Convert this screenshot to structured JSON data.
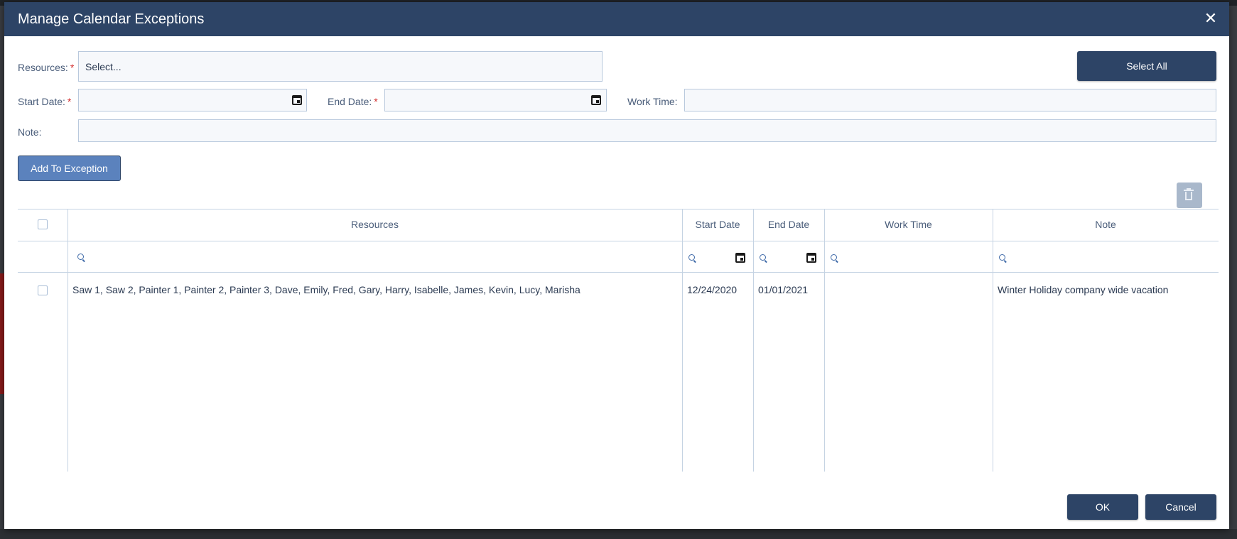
{
  "dialog": {
    "title": "Manage Calendar Exceptions",
    "close_glyph": "✕"
  },
  "form": {
    "resources_label": "Resources:",
    "resources_placeholder": "Select...",
    "select_all_label": "Select All",
    "start_date_label": "Start Date:",
    "start_date_value": "",
    "end_date_label": "End Date:",
    "end_date_value": "",
    "work_time_label": "Work Time:",
    "work_time_value": "",
    "note_label": "Note:",
    "note_value": "",
    "required_mark": "*",
    "add_button_label": "Add To Exception"
  },
  "grid": {
    "columns": [
      "Resources",
      "Start Date",
      "End Date",
      "Work Time",
      "Note"
    ],
    "rows": [
      {
        "resources": "Saw 1, Saw 2, Painter 1, Painter 2, Painter 3, Dave, Emily, Fred, Gary, Harry, Isabelle, James, Kevin, Lucy, Marisha",
        "start_date": "12/24/2020",
        "end_date": "01/01/2021",
        "work_time": "",
        "note": "Winter Holiday company wide vacation"
      }
    ]
  },
  "footer": {
    "ok_label": "OK",
    "cancel_label": "Cancel"
  },
  "colors": {
    "header": "#2d4466",
    "button_primary": "#2d4466",
    "button_secondary": "#5b82bd",
    "required": "#d22c2c",
    "grid_line": "#c5d3e3"
  },
  "icons": [
    "close-icon",
    "calendar-icon",
    "trash-icon",
    "search-icon",
    "checkbox"
  ]
}
